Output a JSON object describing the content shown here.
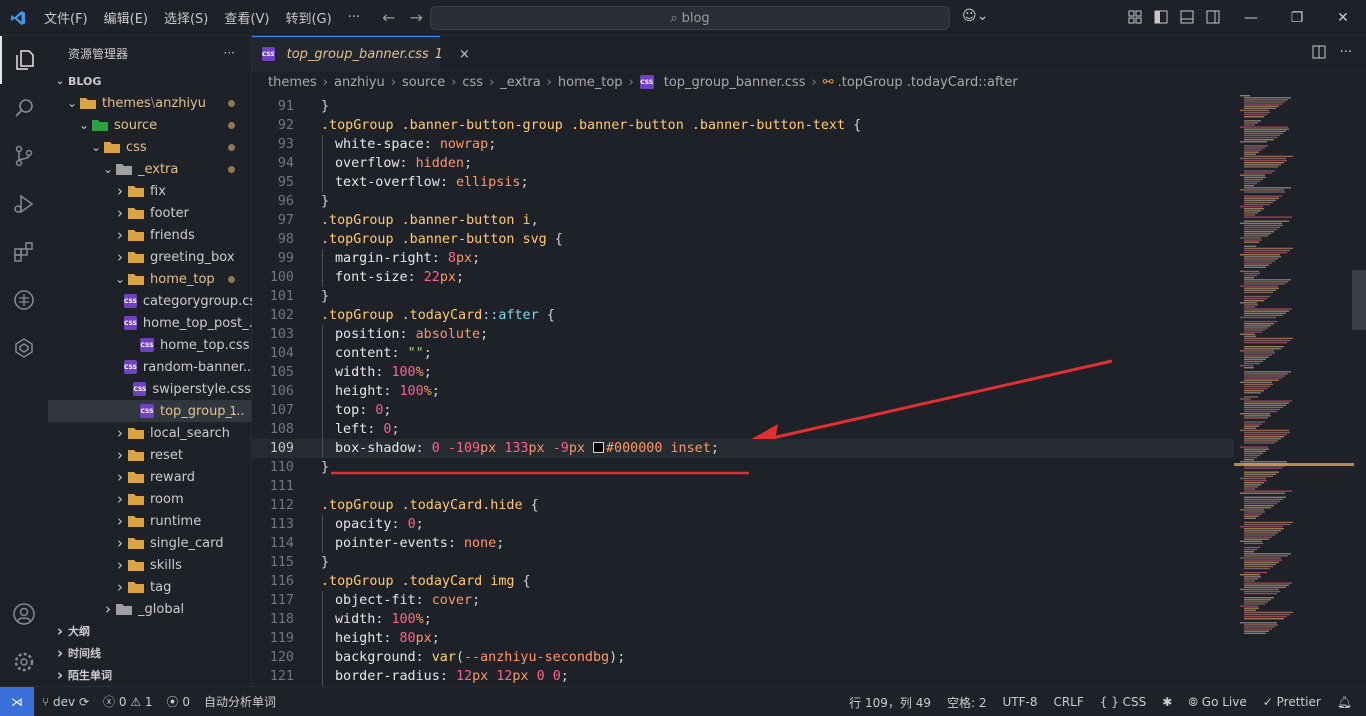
{
  "titlebar": {
    "menus": [
      "文件(F)",
      "编辑(E)",
      "选择(S)",
      "查看(V)",
      "转到(G)",
      "···"
    ],
    "search_text": "blog"
  },
  "sidebar": {
    "title": "资源管理器",
    "more": "···",
    "root": "BLOG",
    "tree": [
      {
        "label": "themes",
        "label2": "anzhiyu",
        "depth": 1,
        "open": true,
        "mod": true,
        "dot": true
      },
      {
        "label": "source",
        "depth": 2,
        "open": true,
        "mod": true,
        "dot": true
      },
      {
        "label": "css",
        "depth": 3,
        "open": true,
        "mod": true,
        "dot": true
      },
      {
        "label": "_extra",
        "depth": 4,
        "open": true,
        "mod": true,
        "dot": true
      },
      {
        "label": "fix",
        "depth": 5,
        "open": false
      },
      {
        "label": "footer",
        "depth": 5,
        "open": false
      },
      {
        "label": "friends",
        "depth": 5,
        "open": false
      },
      {
        "label": "greeting_box",
        "depth": 5,
        "open": false
      },
      {
        "label": "home_top",
        "depth": 5,
        "open": true,
        "mod": true,
        "dot": true
      },
      {
        "label": "categorygroup.css",
        "depth": 6,
        "file": true
      },
      {
        "label": "home_top_post_...",
        "depth": 6,
        "file": true
      },
      {
        "label": "home_top.css",
        "depth": 6,
        "file": true
      },
      {
        "label": "random-banner....",
        "depth": 6,
        "file": true
      },
      {
        "label": "swiperstyle.css",
        "depth": 6,
        "file": true
      },
      {
        "label": "top_group_...",
        "depth": 6,
        "file": true,
        "mod": true,
        "selected": true,
        "badge": "1"
      },
      {
        "label": "local_search",
        "depth": 5,
        "open": false
      },
      {
        "label": "reset",
        "depth": 5,
        "open": false
      },
      {
        "label": "reward",
        "depth": 5,
        "open": false
      },
      {
        "label": "room",
        "depth": 5,
        "open": false
      },
      {
        "label": "runtime",
        "depth": 5,
        "open": false
      },
      {
        "label": "single_card",
        "depth": 5,
        "open": false
      },
      {
        "label": "skills",
        "depth": 5,
        "open": false
      },
      {
        "label": "tag",
        "depth": 5,
        "open": false
      },
      {
        "label": "_global",
        "depth": 4,
        "open": false
      }
    ],
    "sections": [
      "大纲",
      "时间线",
      "陌生单词"
    ]
  },
  "tab": {
    "label": "top_group_banner.css",
    "badge": "1",
    "close": "×",
    "icon": "CSS"
  },
  "breadcrumb": [
    "themes",
    "anzhiyu",
    "source",
    "css",
    "_extra",
    "home_top",
    "top_group_banner.css",
    ".topGroup .todayCard::after"
  ],
  "code": [
    {
      "n": "91",
      "t": "}"
    },
    {
      "n": "92",
      "t": ".topGroup .banner-button-group .banner-button .banner-button-text {"
    },
    {
      "n": "93",
      "p": "white-space",
      "v": "nowrap"
    },
    {
      "n": "94",
      "p": "overflow",
      "v": "hidden"
    },
    {
      "n": "95",
      "p": "text-overflow",
      "v": "ellipsis"
    },
    {
      "n": "96",
      "t": "}"
    },
    {
      "n": "97",
      "t": ".topGroup .banner-button i,"
    },
    {
      "n": "98",
      "t": ".topGroup .banner-button svg {"
    },
    {
      "n": "99",
      "p": "margin-right",
      "v": "8px"
    },
    {
      "n": "100",
      "p": "font-size",
      "v": "22px"
    },
    {
      "n": "101",
      "t": "}"
    },
    {
      "n": "102",
      "t": ".topGroup .todayCard::after {"
    },
    {
      "n": "103",
      "p": "position",
      "v": "absolute"
    },
    {
      "n": "104",
      "p": "content",
      "v": "\"\""
    },
    {
      "n": "105",
      "p": "width",
      "v": "100%"
    },
    {
      "n": "106",
      "p": "height",
      "v": "100%"
    },
    {
      "n": "107",
      "p": "top",
      "v": "0"
    },
    {
      "n": "108",
      "p": "left",
      "v": "0"
    },
    {
      "n": "109",
      "p": "box-shadow",
      "v": "0 -109px 133px -9px #000000 inset"
    },
    {
      "n": "110",
      "t": "}"
    },
    {
      "n": "111",
      "t": ""
    },
    {
      "n": "112",
      "t": ".topGroup .todayCard.hide {"
    },
    {
      "n": "113",
      "p": "opacity",
      "v": "0"
    },
    {
      "n": "114",
      "p": "pointer-events",
      "v": "none"
    },
    {
      "n": "115",
      "t": "}"
    },
    {
      "n": "116",
      "t": ".topGroup .todayCard img {"
    },
    {
      "n": "117",
      "p": "object-fit",
      "v": "cover"
    },
    {
      "n": "118",
      "p": "width",
      "v": "100%"
    },
    {
      "n": "119",
      "p": "height",
      "v": "80px"
    },
    {
      "n": "120",
      "p": "background",
      "v": "var(--anzhiyu-secondbg)"
    },
    {
      "n": "121",
      "p": "border-radius",
      "v": "12px 12px 0 0"
    }
  ],
  "status": {
    "branch": "dev",
    "errors": "0",
    "warnings": "1",
    "ports": "0",
    "spell": "自动分析单词",
    "position": "行 109，列 49",
    "spaces": "空格: 2",
    "encoding": "UTF-8",
    "eol": "CRLF",
    "language": "CSS",
    "golive": "Go Live",
    "prettier": "Prettier"
  },
  "colors": {
    "accent": "#3794ff",
    "modified": "#e2c08d",
    "annotation": "#e03030"
  }
}
